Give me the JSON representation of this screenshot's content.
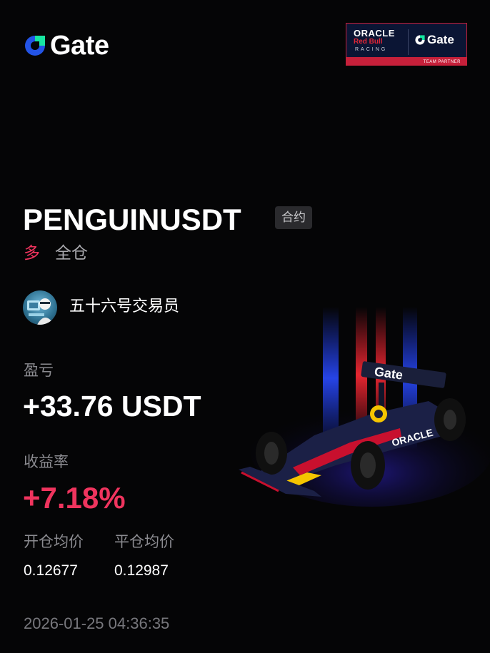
{
  "brand": {
    "logo_text": "Gate",
    "logo_icon": "gate-logo-icon",
    "accent_color": "#2354e6",
    "logo_green": "#17e5a0"
  },
  "partner_badge": {
    "line1": "ORACLE",
    "line2": "Red Bull",
    "line3": "RACING",
    "gate_text": "Gate",
    "caption": "TEAM PARTNER"
  },
  "position": {
    "symbol": "PENGUINUSDT",
    "contract_type": "合约",
    "side": "多",
    "margin_mode": "全仓"
  },
  "trader": {
    "name": "五十六号交易员",
    "avatar_icon": "avatar-icon"
  },
  "pnl": {
    "label": "盈亏",
    "value": "+33.76 USDT"
  },
  "roi": {
    "label": "收益率",
    "value": "+7.18%"
  },
  "prices": {
    "entry_label": "开仓均价",
    "entry_value": "0.12677",
    "close_label": "平仓均价",
    "close_value": "0.12987"
  },
  "timestamp": "2026-01-25 04:36:35",
  "hero_image": {
    "icon": "race-car-icon",
    "livery_text": "Gate",
    "sponsor_text": "ORACLE"
  },
  "colors": {
    "positive": "#f0345e",
    "background": "#050506"
  }
}
